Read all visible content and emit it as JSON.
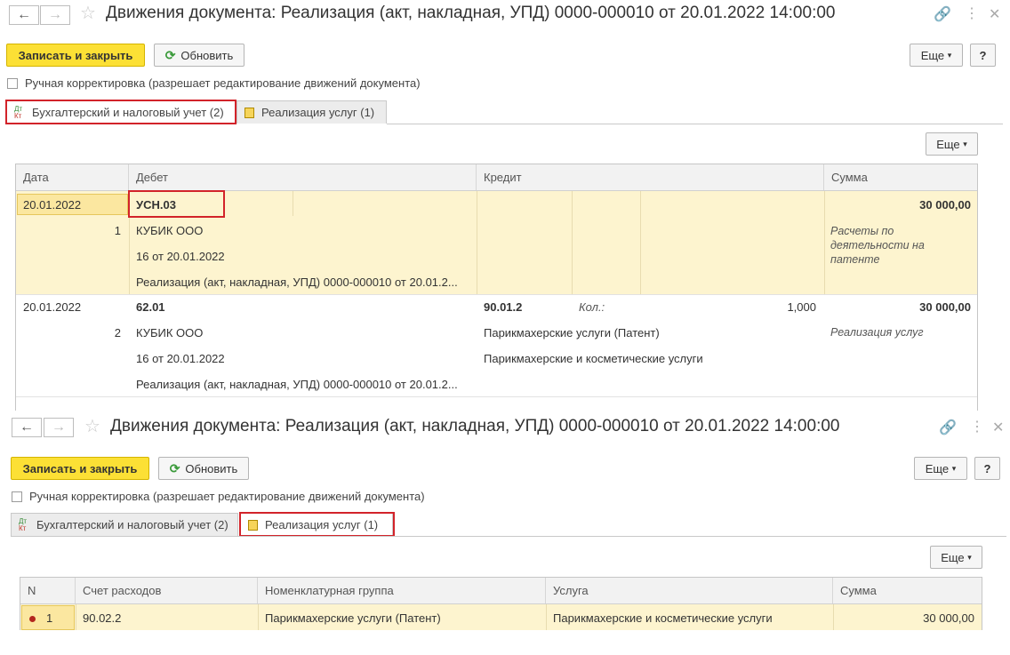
{
  "window": {
    "title": "Движения документа: Реализация (акт, накладная, УПД) 0000-000010 от 20.01.2022 14:00:00"
  },
  "toolbar": {
    "save_close": "Записать и закрыть",
    "refresh": "Обновить",
    "more": "Еще",
    "more_arrow": "▾",
    "help": "?"
  },
  "manual_correction": {
    "label": "Ручная корректировка (разрешает редактирование движений документа)",
    "checked": false
  },
  "tabs": {
    "accounting": "Бухгалтерский и налоговый учет (2)",
    "services": "Реализация услуг (1)",
    "dtkt_top": "Дт",
    "dtkt_bottom": "Кт"
  },
  "icons": {
    "back": "←",
    "forward": "→",
    "star": "☆",
    "link": "🔗",
    "more_vert": "⋮",
    "close": "✕",
    "refresh": "⟳"
  },
  "accounting_table": {
    "more": "Еще",
    "headers": [
      "Дата",
      "Дебет",
      "Кредит",
      "Сумма"
    ],
    "rows": [
      {
        "date": "20.01.2022",
        "num": "1",
        "debit_account": "УСН.03",
        "debit_sub1": "КУБИК ООО",
        "debit_sub2": "16 от 20.01.2022",
        "debit_sub3": "Реализация (акт, накладная, УПД) 0000-000010 от 20.01.2...",
        "credit_account": "",
        "credit_sub1": "",
        "credit_sub2": "",
        "qty_label": "",
        "qty": "",
        "amount": "30 000,00",
        "amount_note": "Расчеты по деятельности на патенте"
      },
      {
        "date": "20.01.2022",
        "num": "2",
        "debit_account": "62.01",
        "debit_sub1": "КУБИК ООО",
        "debit_sub2": "16 от 20.01.2022",
        "debit_sub3": "Реализация (акт, накладная, УПД) 0000-000010 от 20.01.2...",
        "credit_account": "90.01.2",
        "credit_sub1": "Парикмахерские услуги (Патент)",
        "credit_sub2": "Парикмахерские и косметические услуги",
        "qty_label": "Кол.:",
        "qty": "1,000",
        "amount": "30 000,00",
        "amount_note": "Реализация услуг"
      }
    ]
  },
  "services_table": {
    "more": "Еще",
    "headers": [
      "N",
      "Счет расходов",
      "Номенклатурная группа",
      "Услуга",
      "Сумма"
    ],
    "rows": [
      {
        "n": "1",
        "expense_account": "90.02.2",
        "nomenclature_group": "Парикмахерские услуги (Патент)",
        "service": "Парикмахерские и косметические услуги",
        "amount": "30 000,00"
      }
    ]
  },
  "colors": {
    "highlight_red": "#d2232a",
    "save_button": "#fce035",
    "selected_row": "#fdf4cf"
  }
}
